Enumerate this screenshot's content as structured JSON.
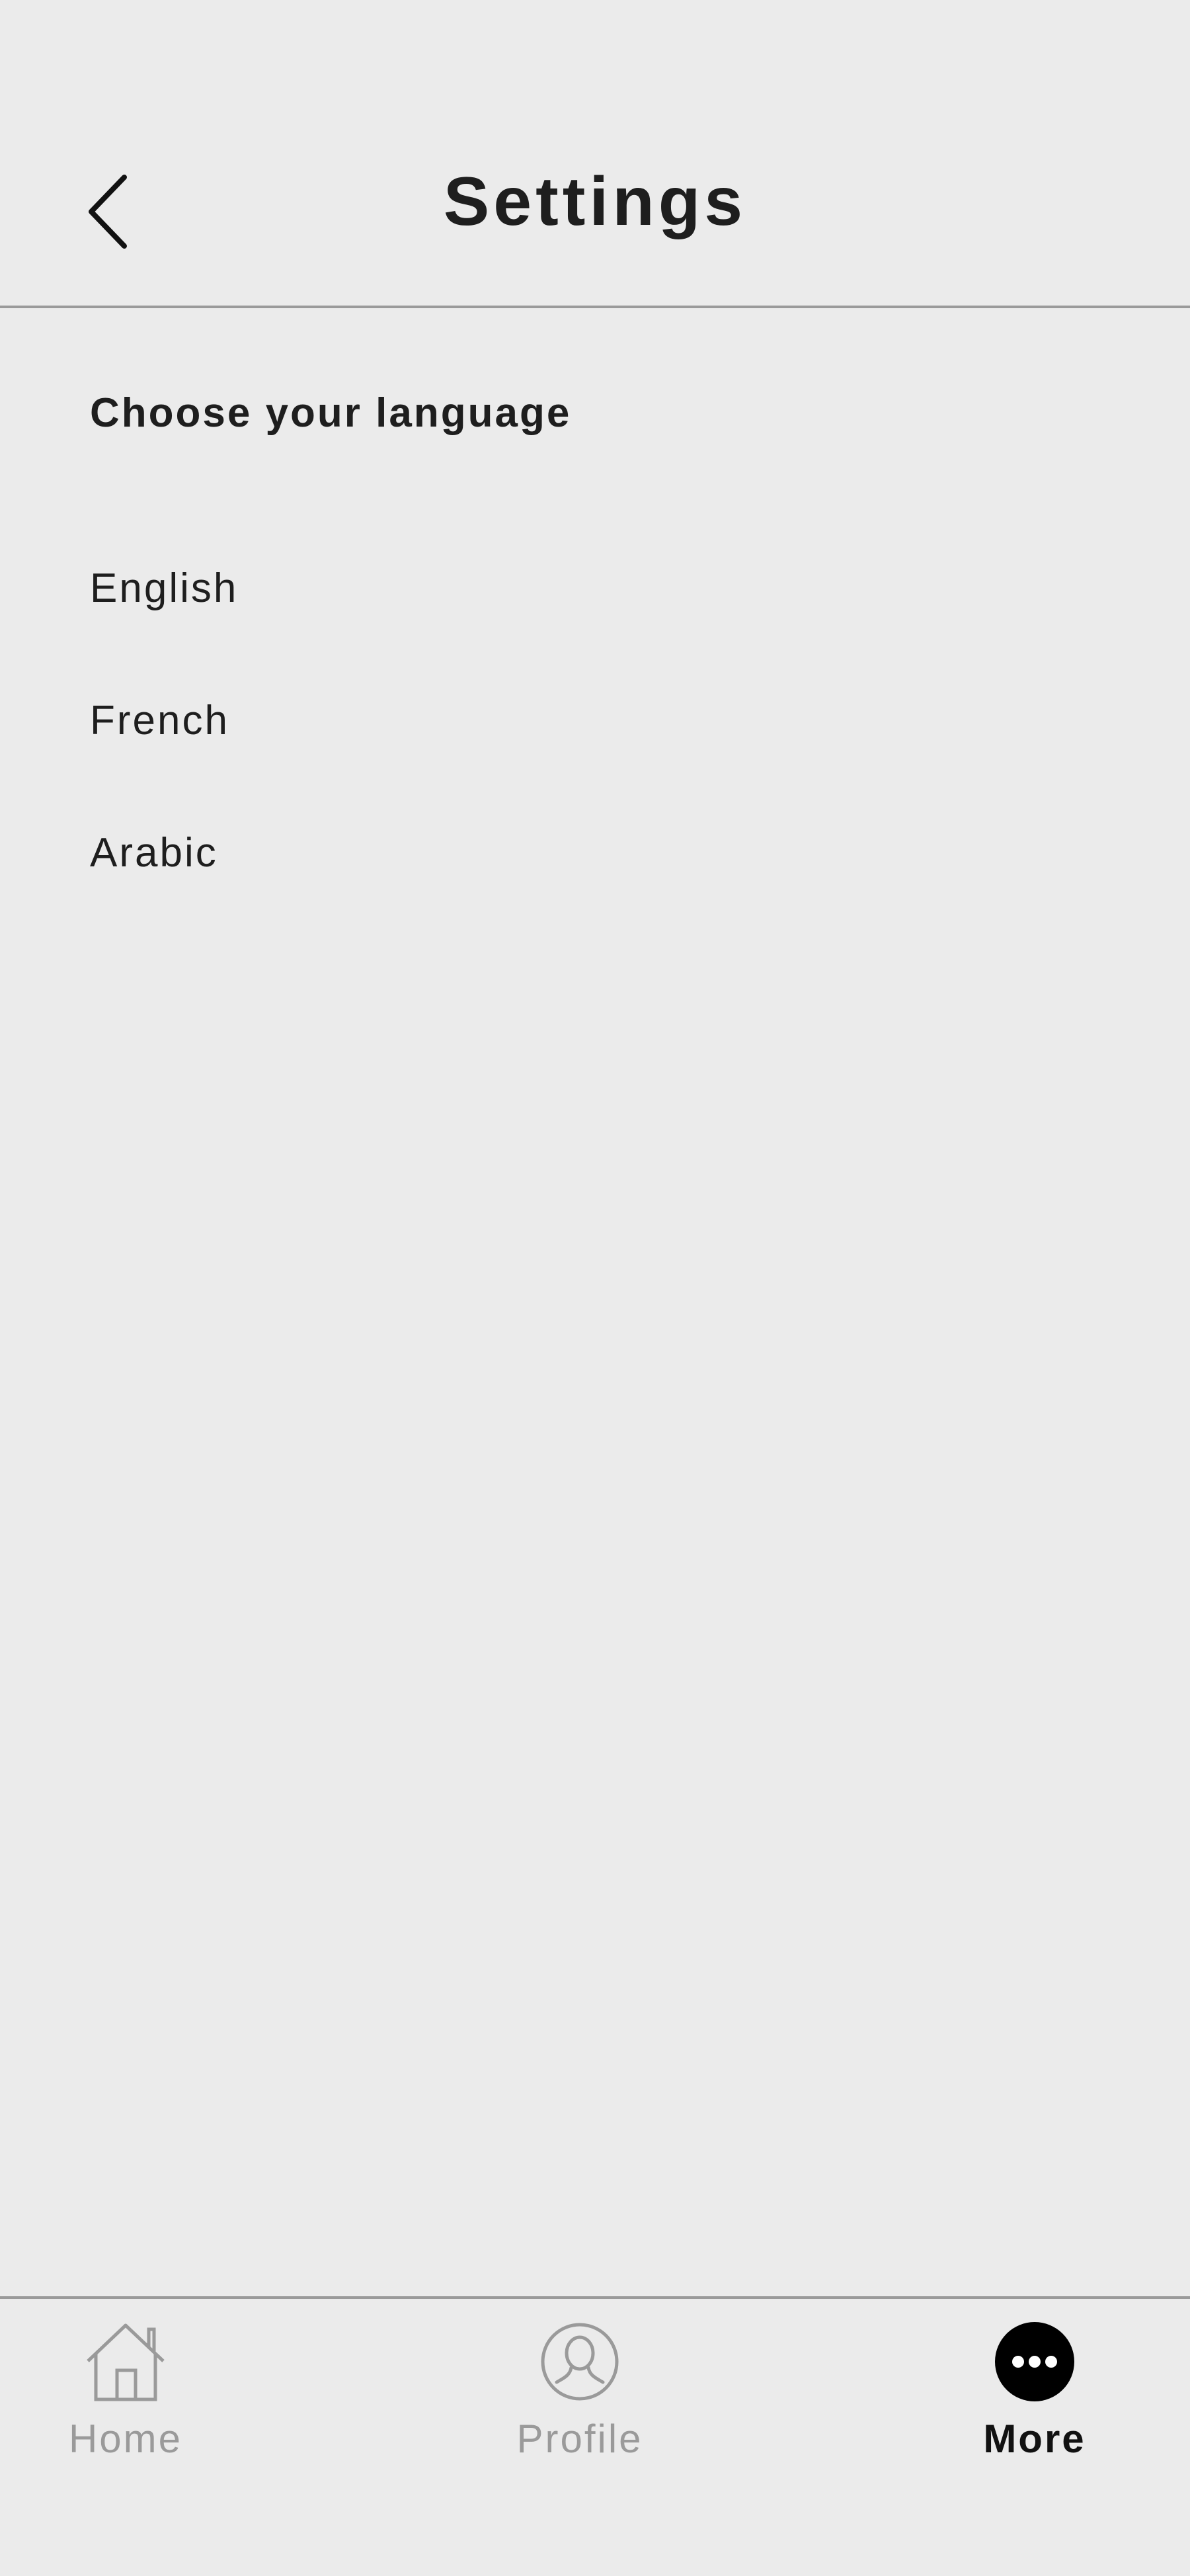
{
  "header": {
    "title": "Settings",
    "back_icon": "chevron-left-icon"
  },
  "language": {
    "section_title": "Choose your language",
    "options": [
      {
        "label": "English"
      },
      {
        "label": "French"
      },
      {
        "label": "Arabic"
      }
    ]
  },
  "tabbar": {
    "tabs": [
      {
        "label": "Home",
        "icon": "home-icon",
        "active": false
      },
      {
        "label": "Profile",
        "icon": "profile-icon",
        "active": false
      },
      {
        "label": "More",
        "icon": "more-icon",
        "active": true
      }
    ]
  },
  "colors": {
    "background": "#ebebeb",
    "text": "#1e1e1e",
    "inactive": "#9a9a9a",
    "active": "#000000"
  }
}
